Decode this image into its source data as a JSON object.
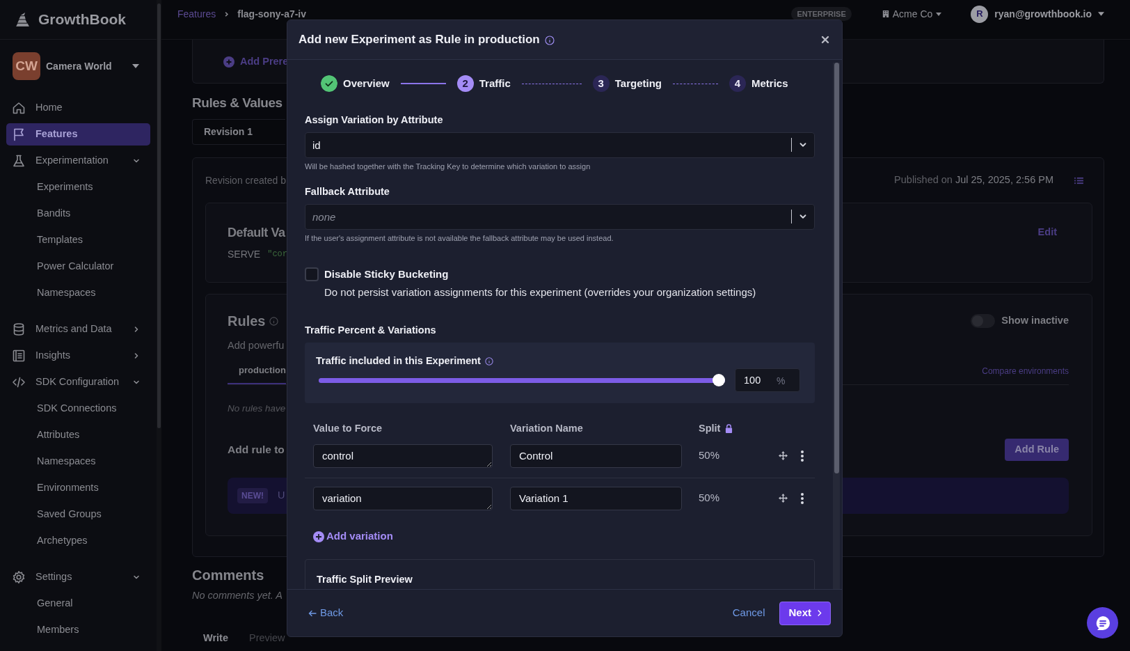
{
  "topbar": {
    "breadcrumb": [
      {
        "label": "Features"
      },
      {
        "label": "flag-sony-a7-iv"
      }
    ],
    "plan_badge": "ENTERPRISE",
    "org_switcher": "Acme Co",
    "user": {
      "initial": "R",
      "email": "ryan@growthbook.io"
    }
  },
  "sidebar": {
    "logo": "GrowthBook",
    "org": {
      "initials": "CW",
      "name": "Camera World"
    },
    "items": [
      {
        "label": "Home",
        "selected": false
      },
      {
        "label": "Features",
        "selected": true
      },
      {
        "label": "Experimentation",
        "selected": false,
        "expanded": true,
        "children": [
          {
            "label": "Experiments",
            "selected": false
          },
          {
            "label": "Bandits",
            "selected": false
          },
          {
            "label": "Templates",
            "selected": false
          },
          {
            "label": "Power Calculator",
            "selected": false
          },
          {
            "label": "Namespaces",
            "selected": false
          }
        ]
      },
      {
        "label": "Metrics and Data",
        "selected": false,
        "expanded": false
      },
      {
        "label": "Insights",
        "selected": false,
        "expanded": false
      },
      {
        "label": "SDK Configuration",
        "selected": false,
        "expanded": true,
        "children": [
          {
            "label": "SDK Connections",
            "selected": false
          },
          {
            "label": "Attributes",
            "selected": false
          },
          {
            "label": "Namespaces",
            "selected": false
          },
          {
            "label": "Environments",
            "selected": false
          },
          {
            "label": "Saved Groups",
            "selected": false
          },
          {
            "label": "Archetypes",
            "selected": false
          }
        ]
      },
      {
        "label": "Settings",
        "selected": false,
        "expanded": true,
        "children": [
          {
            "label": "General",
            "selected": false
          },
          {
            "label": "Members",
            "selected": false
          }
        ]
      }
    ]
  },
  "page": {
    "add_prerequisite": "Add Prere",
    "section_title": "Rules & Values",
    "revision": "Revision 1",
    "revision_note": "Revision created b",
    "published_label": "Published on",
    "published_date": "Jul 25, 2025, 2:56 PM",
    "default_value": {
      "title": "Default Va",
      "serve": "SERVE",
      "value": "\"cor",
      "edit": "Edit"
    },
    "rules": {
      "title": "Rules",
      "subtitle": "Add powerfu",
      "show_inactive": {
        "label": "Show inactive",
        "on": false
      },
      "tabs": [
        {
          "label": "production",
          "selected": true
        }
      ],
      "compare": "Compare environments",
      "empty": "No rules have",
      "add_title": "Add rule to",
      "add_button": "Add Rule",
      "banner": {
        "badge": "NEW!",
        "text": "U"
      }
    },
    "comments": {
      "title": "Comments",
      "empty": "No comments yet. A",
      "tabs": [
        {
          "label": "Write",
          "selected": true
        },
        {
          "label": "Preview",
          "selected": false
        }
      ]
    }
  },
  "modal": {
    "title": "Add new Experiment as Rule in production",
    "steps": [
      {
        "label": "Overview",
        "completed": true,
        "selected": false
      },
      {
        "number": "2",
        "label": "Traffic",
        "completed": false,
        "selected": true
      },
      {
        "number": "3",
        "label": "Targeting",
        "completed": false,
        "selected": false
      },
      {
        "number": "4",
        "label": "Metrics",
        "completed": false,
        "selected": false
      }
    ],
    "hash_attribute": {
      "label": "Assign Variation by Attribute",
      "value": "id",
      "help": "Will be hashed together with the Tracking Key to determine which variation to assign"
    },
    "fallback_attribute": {
      "label": "Fallback Attribute",
      "placeholder": "none",
      "help": "If the user's assignment attribute is not available the fallback attribute may be used instead."
    },
    "sticky_bucketing": {
      "label": "Disable Sticky Bucketing",
      "description": "Do not persist variation assignments for this experiment (overrides your organization settings)",
      "checked": false
    },
    "traffic": {
      "section_title": "Traffic Percent & Variations",
      "label": "Traffic included in this Experiment",
      "level": 1,
      "value": "100",
      "unit": "%"
    },
    "variations": {
      "columns": [
        "Value to Force",
        "Variation Name",
        "Split"
      ],
      "rows": [
        {
          "value": "control",
          "name": "Control",
          "split": "50%"
        },
        {
          "value": "variation",
          "name": "Variation 1",
          "split": "50%"
        }
      ],
      "add_label": "Add variation"
    },
    "preview_title": "Traffic Split Preview",
    "footer": {
      "back": "Back",
      "cancel": "Cancel",
      "next": "Next"
    }
  }
}
